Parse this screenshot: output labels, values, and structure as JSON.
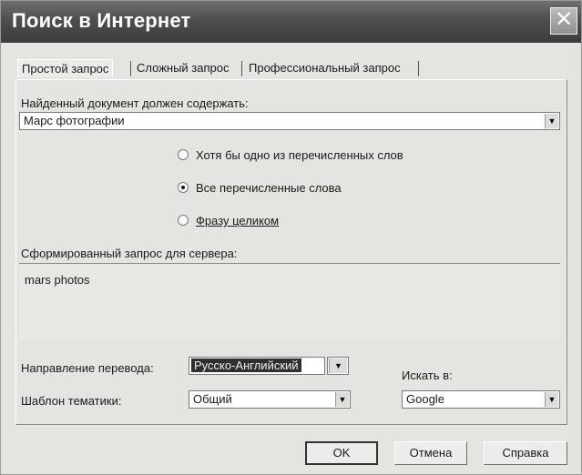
{
  "window": {
    "title": "Поиск в Интернет",
    "close_glyph": "✕"
  },
  "tabs": [
    {
      "label": "Простой запрос"
    },
    {
      "label": "Сложный запрос"
    },
    {
      "label": "Профессиональный запрос"
    }
  ],
  "found": {
    "label": "Найденный документ должен содержать:",
    "value": "Марс фотографии"
  },
  "radios": [
    {
      "label": "Хотя бы одно из перечисленных слов",
      "checked": false
    },
    {
      "label": "Все перечисленные слова",
      "checked": true
    },
    {
      "label": "Фразу целиком",
      "checked": false
    }
  ],
  "query": {
    "label": "Сформированный запрос для сервера:",
    "value": "mars photos"
  },
  "direction": {
    "label": "Направление перевода:",
    "value": "Русско-Английский"
  },
  "template": {
    "label": "Шаблон тематики:",
    "value": "Общий"
  },
  "search_in": {
    "label": "Искать в:",
    "value": "Google"
  },
  "buttons": {
    "ok": "OK",
    "cancel": "Отмена",
    "help": "Справка"
  }
}
